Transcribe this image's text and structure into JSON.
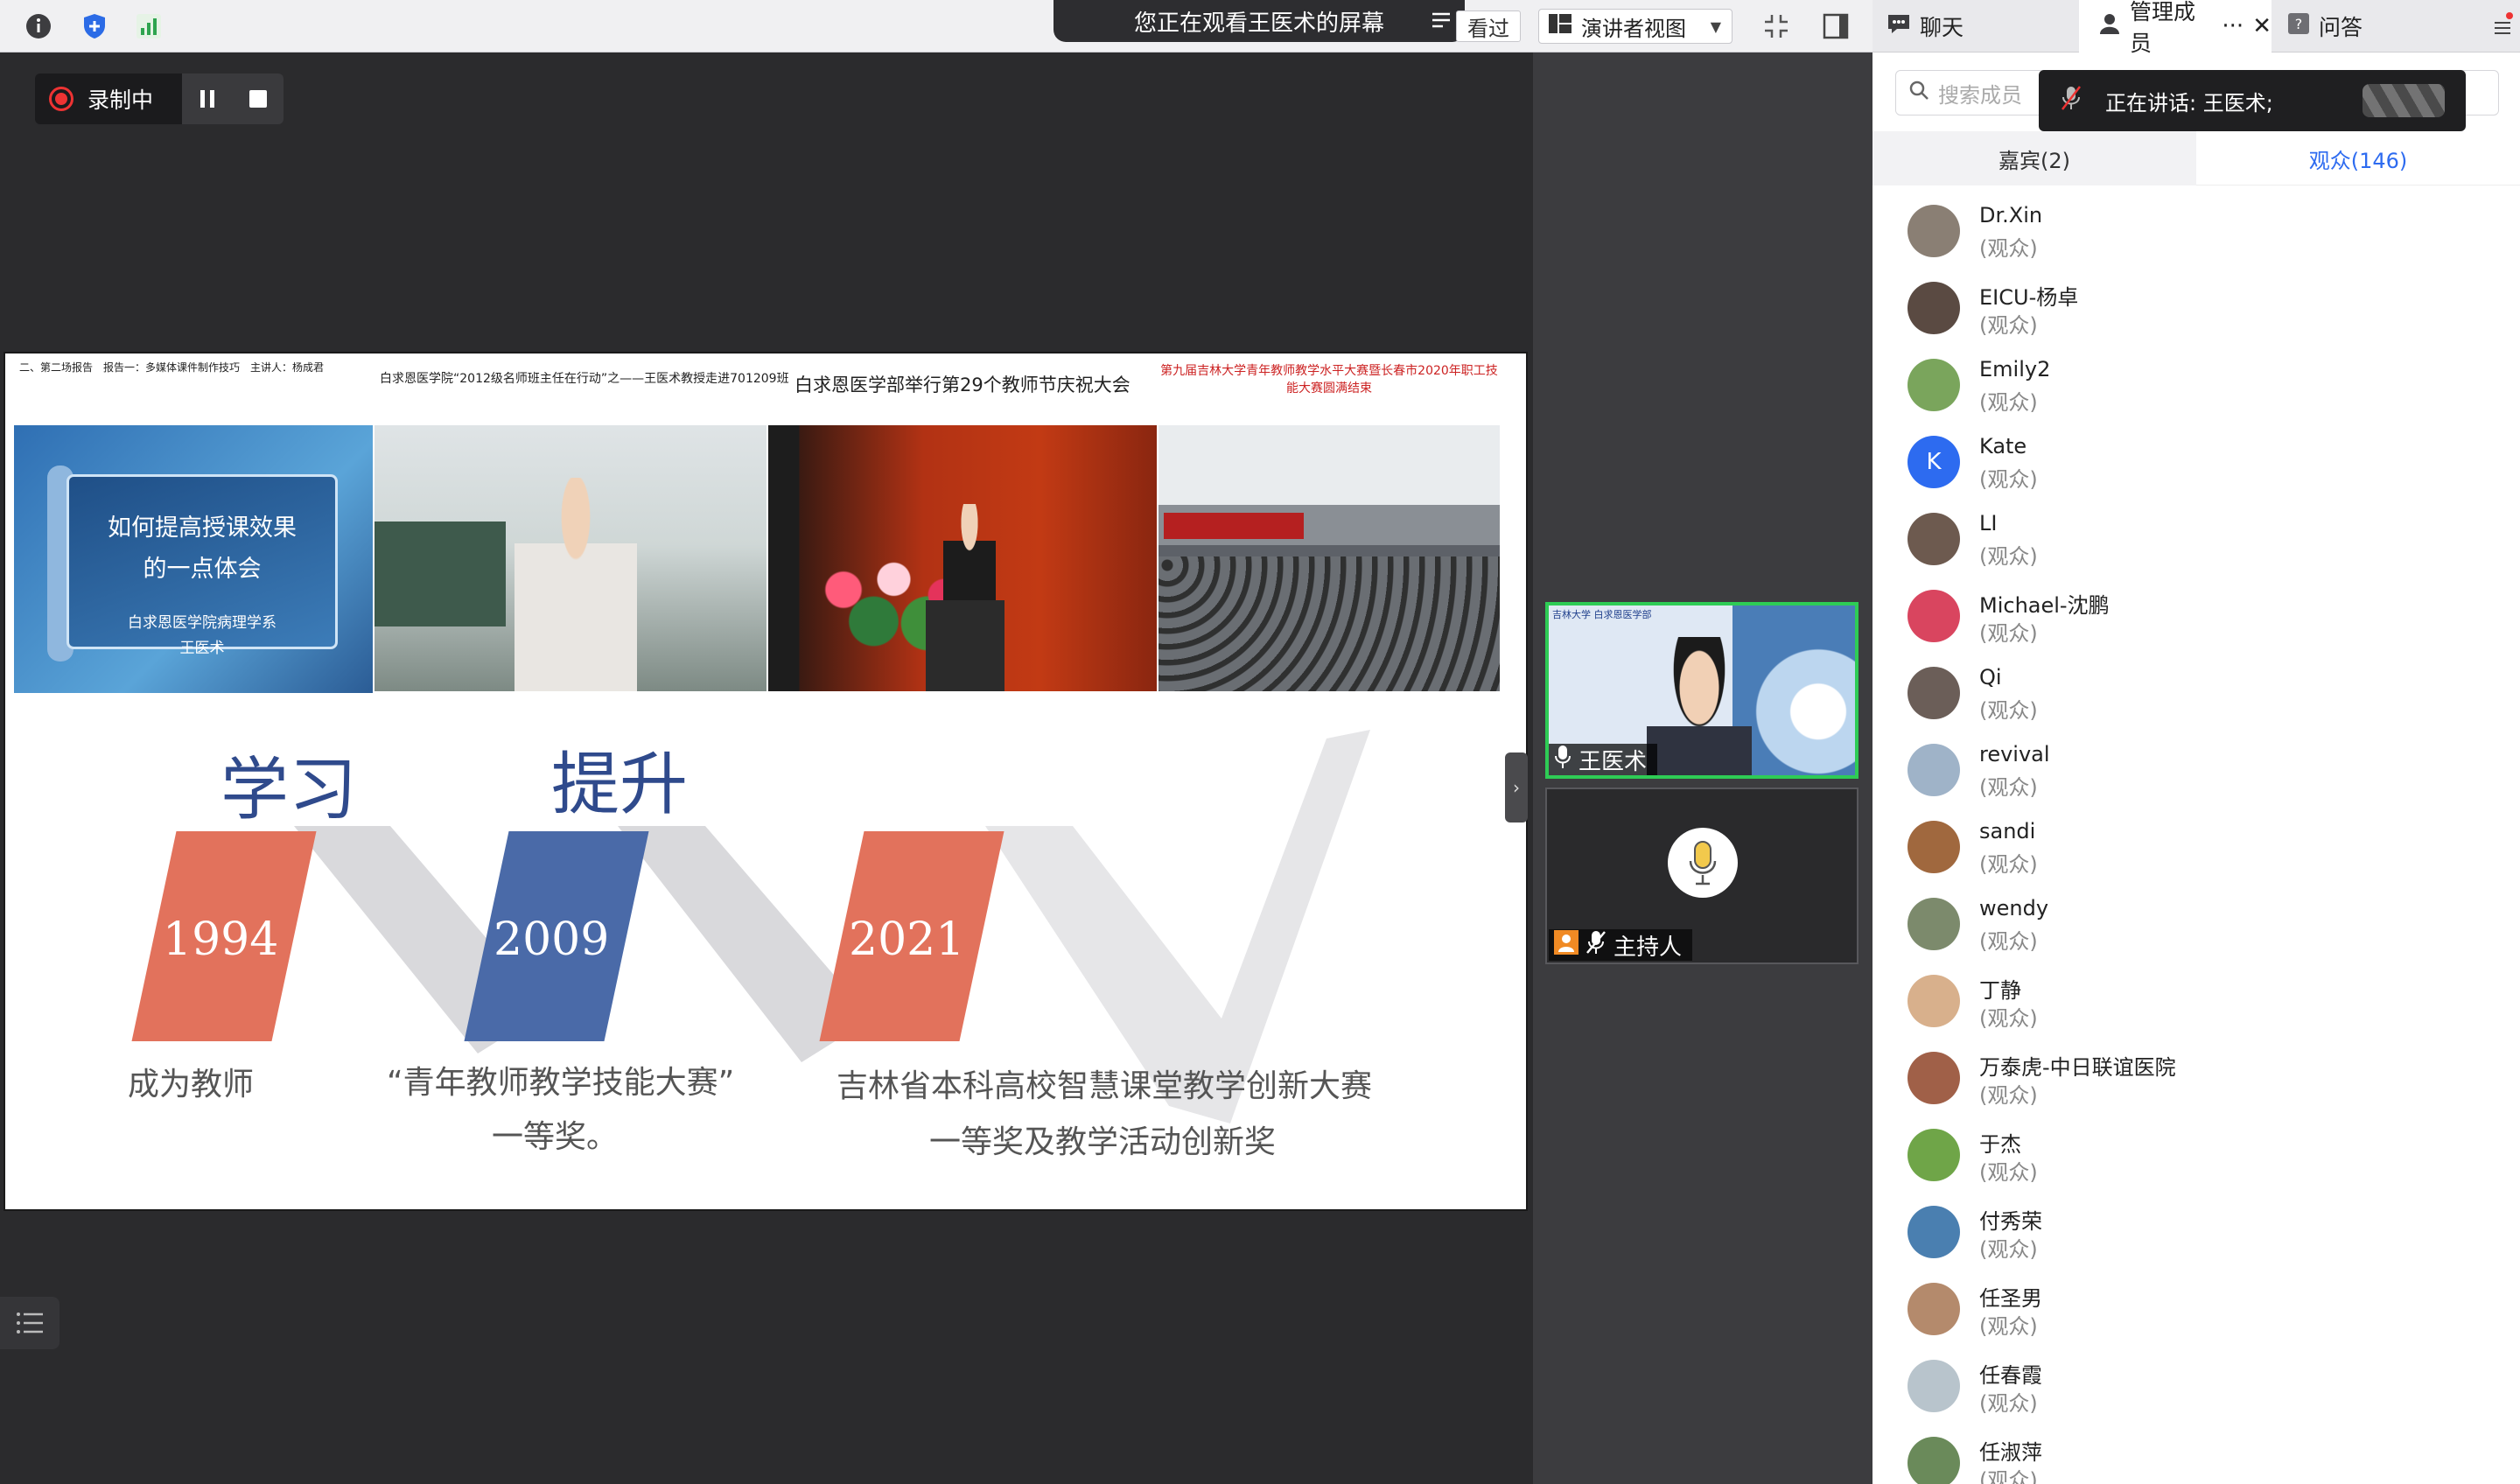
{
  "toolbar": {
    "banner_text": "您正在观看王医术的屏幕",
    "skip_chip": "看过",
    "view_mode": "演讲者视图"
  },
  "recording": {
    "label": "录制中"
  },
  "slide": {
    "captions": [
      "二、第二场报告　报告一：多媒体课件制作技巧　主讲人：杨成君",
      "白求恩医学院“2012级名师班主任在行动”之——王医术教授走进701209班",
      "白求恩医学部举行第29个教师节庆祝大会",
      "第九届吉林大学青年教师教学水平大赛暨长春市2020年职工技能大赛圆满结束"
    ],
    "photo1_lines": [
      "如何提高授课效果",
      "的一点体会",
      "白求恩医学院病理学系",
      "王医术"
    ],
    "heading_learn": "学习",
    "heading_improve": "提升",
    "milestones": [
      {
        "year": "1994",
        "line1": "成为教师",
        "line2": ""
      },
      {
        "year": "2009",
        "line1": "“青年教师教学技能大赛”",
        "line2": "一等奖。"
      },
      {
        "year": "2021",
        "line1": "吉林省本科高校智慧课堂教学创新大赛",
        "line2": "一等奖及教学活动创新奖"
      }
    ]
  },
  "videos": {
    "speaker_name": "王医术",
    "host_name": "主持人",
    "speaker_tile_header": "吉林大学 白求恩医学部"
  },
  "panel": {
    "tabs": {
      "chat": "聊天",
      "members": "管理成员",
      "qa": "问答"
    },
    "search_placeholder": "搜索成员",
    "speaking": "正在讲话: 王医术;",
    "sub_tabs": {
      "guests": "嘉宾(2)",
      "audience": "观众(146)"
    },
    "members": [
      {
        "name": "Dr.Xin",
        "role": "(观众)"
      },
      {
        "name": "EICU-杨卓",
        "role": "(观众)"
      },
      {
        "name": "Emily2",
        "role": "(观众)"
      },
      {
        "name": "Kate",
        "role": "(观众)",
        "initial": "K"
      },
      {
        "name": "LI",
        "role": "(观众)"
      },
      {
        "name": "Michael-沈鹏",
        "role": "(观众)"
      },
      {
        "name": "Qi",
        "role": "(观众)"
      },
      {
        "name": "revival",
        "role": "(观众)"
      },
      {
        "name": "sandi",
        "role": "(观众)"
      },
      {
        "name": "wendy",
        "role": "(观众)"
      },
      {
        "name": "丁静",
        "role": "(观众)"
      },
      {
        "name": "万泰虎-中日联谊医院",
        "role": "(观众)"
      },
      {
        "name": "于杰",
        "role": "(观众)"
      },
      {
        "name": "付秀荣",
        "role": "(观众)"
      },
      {
        "name": "任圣男",
        "role": "(观众)"
      },
      {
        "name": "任春霞",
        "role": "(观众)"
      },
      {
        "name": "任淑萍",
        "role": "(观众)"
      }
    ]
  },
  "colors": {
    "accent_blue": "#2d6bf0",
    "milestone_red": "#e2725c",
    "milestone_blue": "#4a6aa8",
    "active_border": "#2ecc55",
    "recording_red": "#e33333"
  }
}
